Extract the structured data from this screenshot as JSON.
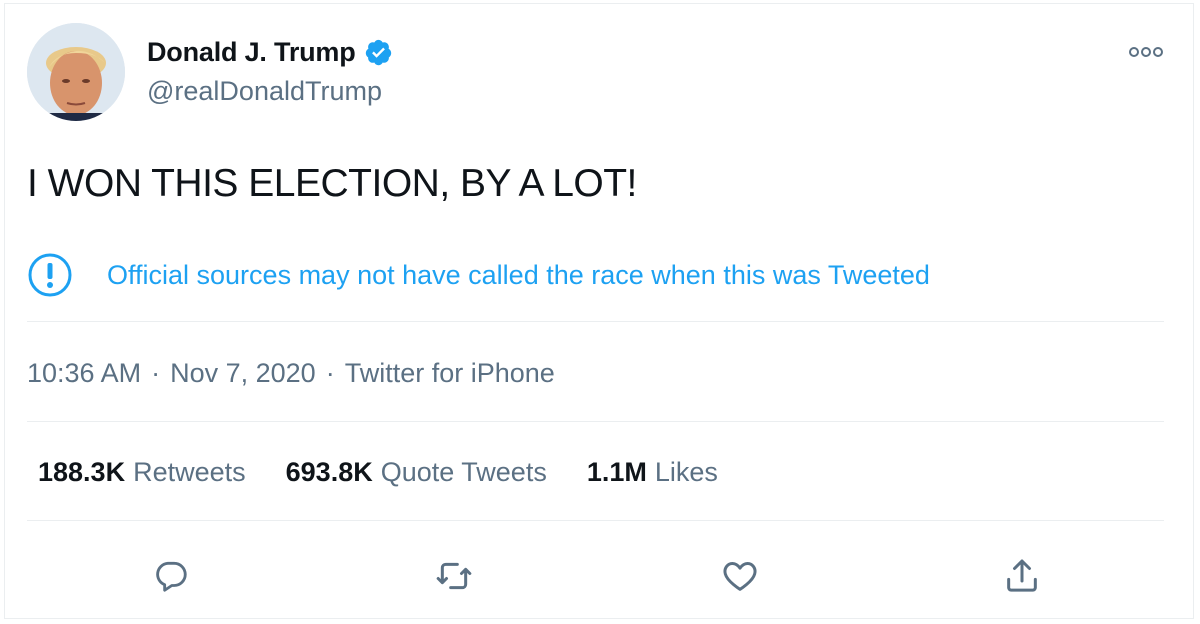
{
  "author": {
    "display_name": "Donald J. Trump",
    "handle": "@realDonaldTrump",
    "verified": true
  },
  "tweet": {
    "text": "I WON THIS ELECTION, BY A LOT!"
  },
  "notice": {
    "icon": "exclamation-circle-icon",
    "text": "Official sources may not have called the race when this was Tweeted"
  },
  "meta": {
    "time": "10:36 AM",
    "date": "Nov 7, 2020",
    "source": "Twitter for iPhone",
    "separator": "·"
  },
  "stats": {
    "retweets": {
      "count": "188.3K",
      "label": "Retweets"
    },
    "quote_tweets": {
      "count": "693.8K",
      "label": "Quote Tweets"
    },
    "likes": {
      "count": "1.1M",
      "label": "Likes"
    }
  },
  "actions": [
    "reply-icon",
    "retweet-icon",
    "like-icon",
    "share-icon"
  ],
  "colors": {
    "accent": "#1da1f2",
    "text": "#0f1419",
    "secondary_text": "#5b7083",
    "divider": "#ebeef0"
  }
}
